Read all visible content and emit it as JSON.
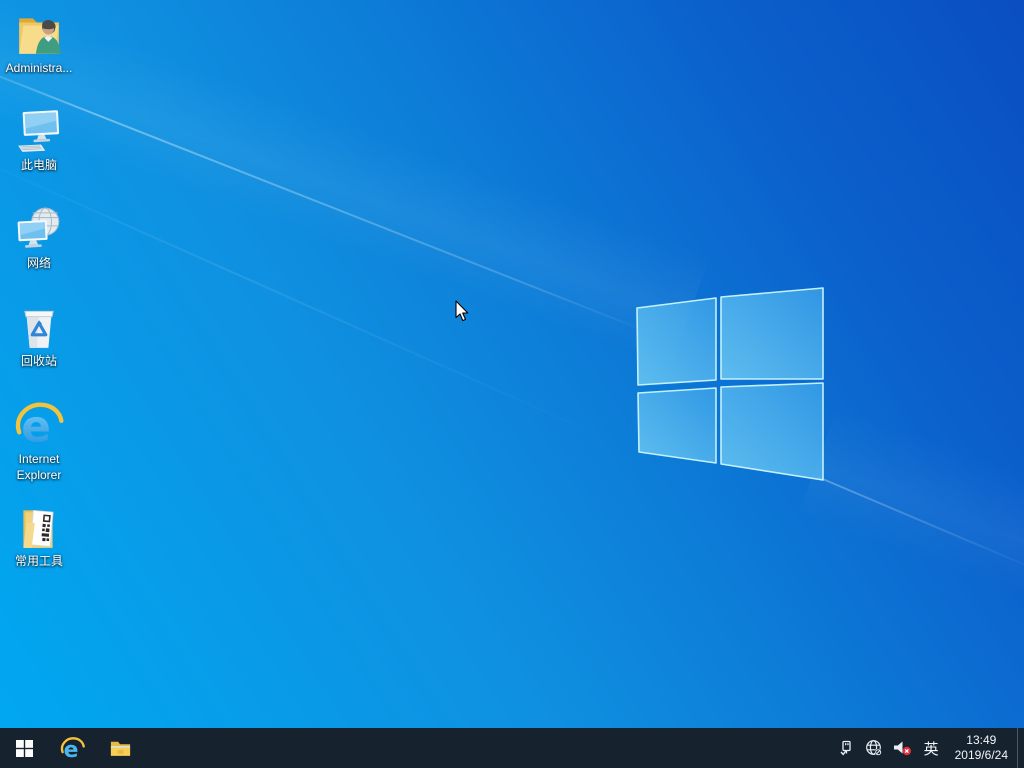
{
  "desktop": {
    "icons": [
      {
        "id": "administrator",
        "label": "Administra...",
        "icon": "user-folder-icon"
      },
      {
        "id": "this-pc",
        "label": "此电脑",
        "icon": "computer-icon"
      },
      {
        "id": "network",
        "label": "网络",
        "icon": "network-globe-icon"
      },
      {
        "id": "recycle-bin",
        "label": "回收站",
        "icon": "recycle-bin-icon"
      },
      {
        "id": "internet-explorer",
        "label": "Internet Explorer",
        "icon": "ie-icon"
      },
      {
        "id": "common-tools",
        "label": "常用工具",
        "icon": "tools-folder-icon"
      }
    ]
  },
  "taskbar": {
    "apps": [
      {
        "id": "internet-explorer",
        "icon": "ie-icon"
      },
      {
        "id": "file-explorer",
        "icon": "folder-icon"
      }
    ],
    "tray_icons": [
      {
        "icon": "usb-device-icon"
      },
      {
        "icon": "network-globe-icon"
      },
      {
        "icon": "volume-muted-icon"
      }
    ],
    "language_indicator": "英",
    "clock": {
      "time": "13:49",
      "date": "2019/6/24"
    }
  },
  "colors": {
    "taskbar": "#16222e",
    "wallpaper_light": "#00a9f2",
    "wallpaper_dark": "#0a4ec2",
    "logo_border": "#c2f1fb",
    "mute_badge": "#e0303a"
  }
}
